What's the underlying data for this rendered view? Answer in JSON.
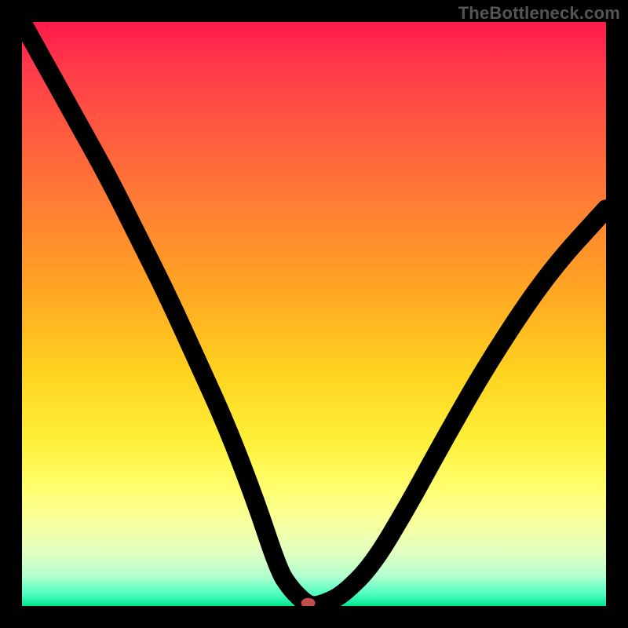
{
  "watermark": "TheBottleneck.com",
  "chart_data": {
    "type": "line",
    "title": "",
    "xlabel": "",
    "ylabel": "",
    "xlim": [
      0,
      100
    ],
    "ylim": [
      0,
      100
    ],
    "grid": false,
    "gradient_stops": [
      {
        "pos": 0,
        "color": "#ff1a4d"
      },
      {
        "pos": 8,
        "color": "#ff3b4a"
      },
      {
        "pos": 18,
        "color": "#ff5840"
      },
      {
        "pos": 30,
        "color": "#ff7a35"
      },
      {
        "pos": 45,
        "color": "#ffa323"
      },
      {
        "pos": 60,
        "color": "#ffd31e"
      },
      {
        "pos": 72,
        "color": "#fff03a"
      },
      {
        "pos": 80,
        "color": "#ffff70"
      },
      {
        "pos": 86,
        "color": "#f8ffa0"
      },
      {
        "pos": 91,
        "color": "#e0ffc0"
      },
      {
        "pos": 95,
        "color": "#b0ffd0"
      },
      {
        "pos": 98,
        "color": "#4cffc0"
      },
      {
        "pos": 100,
        "color": "#00e68c"
      }
    ],
    "series": [
      {
        "name": "curve",
        "comment": "V-shaped curve; y is a metric plotted 0-100 top->bottom in screen space. x,y here are in 0-100 data coords (y=0 at bottom, y=100 at top).",
        "x": [
          0,
          5,
          10,
          15,
          20,
          25,
          30,
          35,
          40,
          44,
          46,
          48,
          49,
          50,
          52,
          55,
          60,
          66,
          72,
          80,
          90,
          100
        ],
        "y": [
          100,
          91,
          82,
          73,
          63,
          53,
          42,
          31,
          18,
          6,
          3,
          1,
          0.3,
          0,
          0.5,
          2,
          7,
          17,
          28,
          42,
          57,
          68
        ]
      }
    ],
    "marker": {
      "comment": "Small oval marker at curve minimum near bottom",
      "x": 49,
      "y": 0.5,
      "color": "#c44f4a"
    }
  }
}
